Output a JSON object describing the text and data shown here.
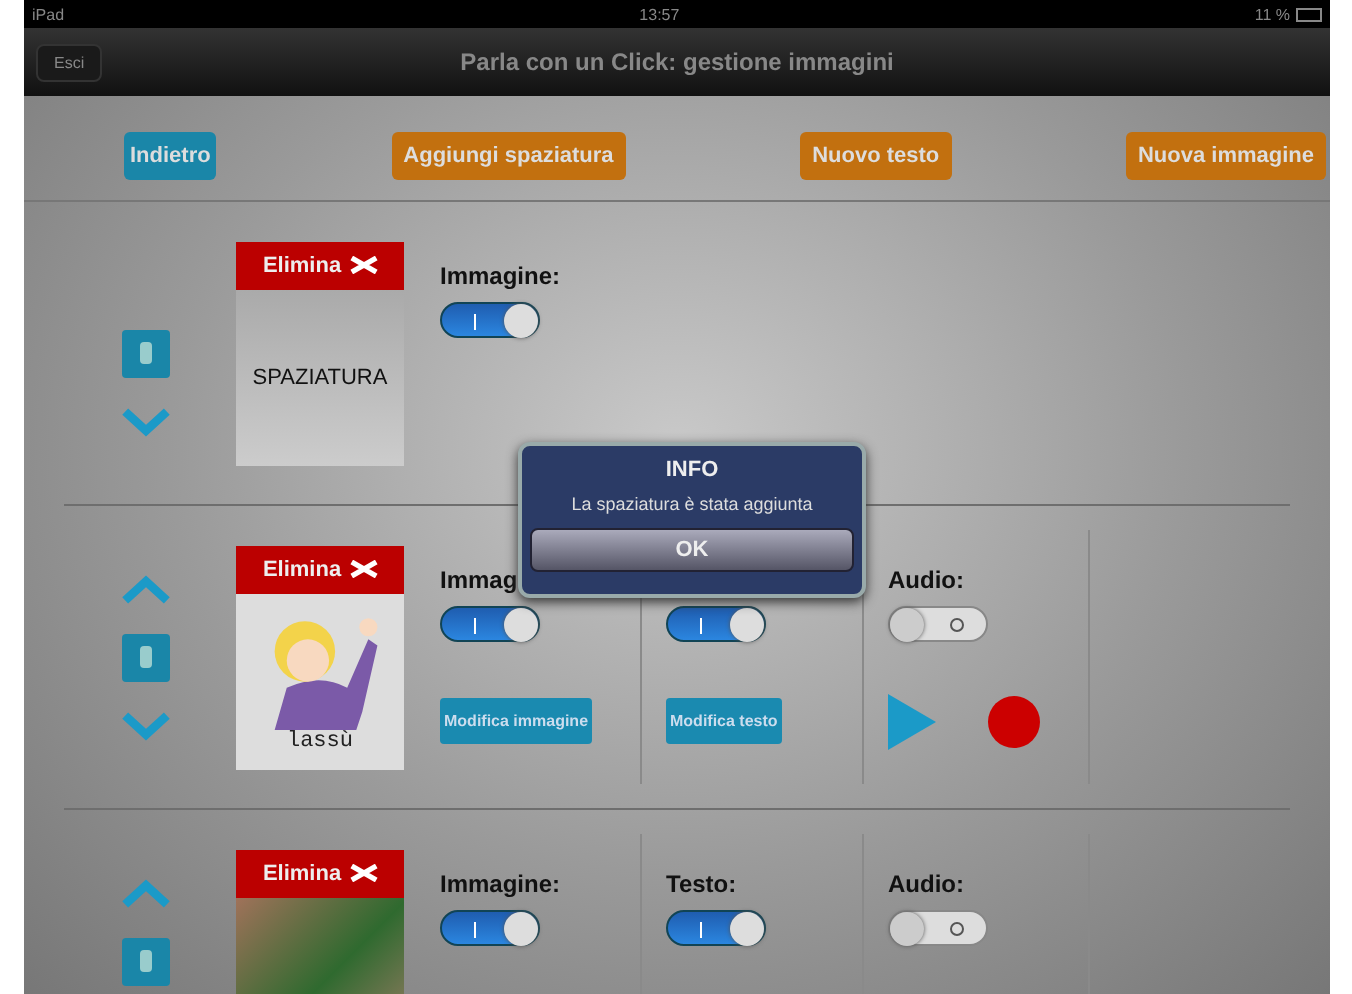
{
  "status_bar": {
    "device": "iPad",
    "time": "13:57",
    "battery": "11 %"
  },
  "nav_bar": {
    "back": "Esci",
    "title": "Parla con un Click: gestione immagini"
  },
  "toolbar": [
    {
      "label": "Indietro",
      "kind": "blue"
    },
    {
      "label": "Aggiungi spaziatura",
      "kind": "orange"
    },
    {
      "label": "Nuovo testo",
      "kind": "orange"
    },
    {
      "label": "Nuova immagine",
      "kind": "orange"
    }
  ],
  "rows": [
    {
      "kind": "spacer",
      "move_up": false,
      "move_down": true,
      "delete": "Elimina",
      "card_text": "SPAZIATURA",
      "columns": [
        {
          "kind": "image",
          "label": "Immagine:",
          "on": true
        }
      ]
    },
    {
      "kind": "picture",
      "move_up": true,
      "move_down": true,
      "delete": "Elimina",
      "caption": "lassù",
      "columns": [
        {
          "kind": "image",
          "label": "Immag",
          "on": true,
          "button": "Modifica immagine"
        },
        {
          "kind": "text",
          "on": true,
          "button": "Modifica testo"
        },
        {
          "kind": "audio",
          "label": "Audio:",
          "on": false
        }
      ]
    },
    {
      "kind": "photo",
      "move_up": true,
      "delete": "Elimina",
      "columns": [
        {
          "kind": "image",
          "label": "Immagine:",
          "on": true
        },
        {
          "kind": "text",
          "label": "Testo:",
          "on": true
        },
        {
          "kind": "audio",
          "label": "Audio:",
          "on": false
        }
      ]
    }
  ],
  "dialog": {
    "title": "INFO",
    "message": "La spaziatura è stata aggiunta",
    "button": "OK"
  }
}
